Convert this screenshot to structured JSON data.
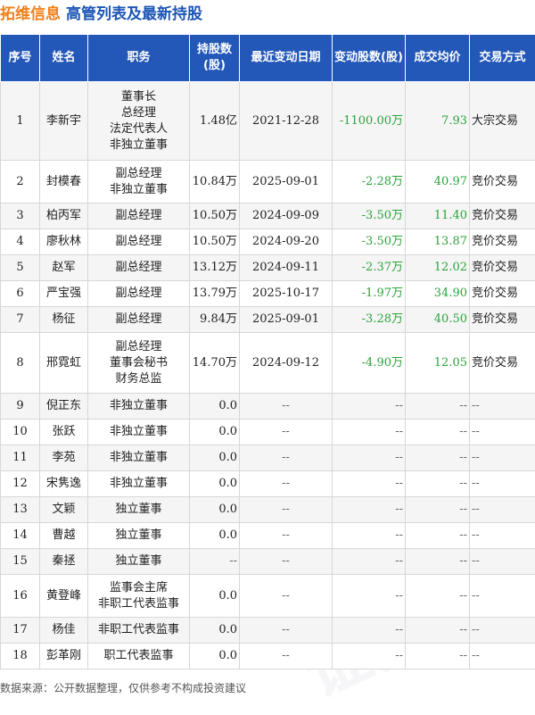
{
  "header": {
    "company": "拓维信息",
    "subtitle": "高管列表及最新持股"
  },
  "columns": [
    "序号",
    "姓名",
    "职务",
    "持股数(股)",
    "最近变动日期",
    "变动股数(股)",
    "成交均价",
    "交易方式"
  ],
  "rows": [
    {
      "no": "1",
      "name": "李新宇",
      "roles": [
        "董事长",
        "总经理",
        "法定代表人",
        "非独立董事"
      ],
      "shares": "1.48亿",
      "date": "2021-12-28",
      "change": "-1100.00万",
      "price": "7.93",
      "method": "大宗交易",
      "h": 88
    },
    {
      "no": "2",
      "name": "封模春",
      "roles": [
        "副总经理",
        "非独立董事"
      ],
      "shares": "10.84万",
      "date": "2025-09-01",
      "change": "-2.28万",
      "price": "40.97",
      "method": "竞价交易",
      "h": 48
    },
    {
      "no": "3",
      "name": "柏丙军",
      "roles": [
        "副总经理"
      ],
      "shares": "10.50万",
      "date": "2024-09-09",
      "change": "-3.50万",
      "price": "11.40",
      "method": "竞价交易",
      "h": 29
    },
    {
      "no": "4",
      "name": "廖秋林",
      "roles": [
        "副总经理"
      ],
      "shares": "10.50万",
      "date": "2024-09-20",
      "change": "-3.50万",
      "price": "13.87",
      "method": "竞价交易",
      "h": 29
    },
    {
      "no": "5",
      "name": "赵军",
      "roles": [
        "副总经理"
      ],
      "shares": "13.12万",
      "date": "2024-09-11",
      "change": "-2.37万",
      "price": "12.02",
      "method": "竞价交易",
      "h": 29
    },
    {
      "no": "6",
      "name": "严宝强",
      "roles": [
        "副总经理"
      ],
      "shares": "13.79万",
      "date": "2025-10-17",
      "change": "-1.97万",
      "price": "34.90",
      "method": "竞价交易",
      "h": 29
    },
    {
      "no": "7",
      "name": "杨征",
      "roles": [
        "副总经理"
      ],
      "shares": "9.84万",
      "date": "2025-09-01",
      "change": "-3.28万",
      "price": "40.50",
      "method": "竞价交易",
      "h": 29
    },
    {
      "no": "8",
      "name": "邢霓虹",
      "roles": [
        "副总经理",
        "董事会秘书",
        "财务总监"
      ],
      "shares": "14.70万",
      "date": "2024-09-12",
      "change": "-4.90万",
      "price": "12.05",
      "method": "竞价交易",
      "h": 68
    },
    {
      "no": "9",
      "name": "倪正东",
      "roles": [
        "非独立董事"
      ],
      "shares": "0.0",
      "date": "--",
      "change": "--",
      "price": "--",
      "method": "--",
      "h": 29
    },
    {
      "no": "10",
      "name": "张跃",
      "roles": [
        "非独立董事"
      ],
      "shares": "0.0",
      "date": "--",
      "change": "--",
      "price": "--",
      "method": "--",
      "h": 29
    },
    {
      "no": "11",
      "name": "李苑",
      "roles": [
        "非独立董事"
      ],
      "shares": "0.0",
      "date": "--",
      "change": "--",
      "price": "--",
      "method": "--",
      "h": 29
    },
    {
      "no": "12",
      "name": "宋隽逸",
      "roles": [
        "非独立董事"
      ],
      "shares": "0.0",
      "date": "--",
      "change": "--",
      "price": "--",
      "method": "--",
      "h": 29
    },
    {
      "no": "13",
      "name": "文颖",
      "roles": [
        "独立董事"
      ],
      "shares": "0.0",
      "date": "--",
      "change": "--",
      "price": "--",
      "method": "--",
      "h": 29
    },
    {
      "no": "14",
      "name": "曹越",
      "roles": [
        "独立董事"
      ],
      "shares": "0.0",
      "date": "--",
      "change": "--",
      "price": "--",
      "method": "--",
      "h": 29
    },
    {
      "no": "15",
      "name": "秦拯",
      "roles": [
        "独立董事"
      ],
      "shares": "--",
      "date": "--",
      "change": "--",
      "price": "--",
      "method": "--",
      "h": 29
    },
    {
      "no": "16",
      "name": "黄登峰",
      "roles": [
        "监事会主席",
        "非职工代表监事"
      ],
      "shares": "0.0",
      "date": "--",
      "change": "--",
      "price": "--",
      "method": "--",
      "h": 48
    },
    {
      "no": "17",
      "name": "杨佳",
      "roles": [
        "非职工代表监事"
      ],
      "shares": "0.0",
      "date": "--",
      "change": "--",
      "price": "--",
      "method": "--",
      "h": 29
    },
    {
      "no": "18",
      "name": "彭革刚",
      "roles": [
        "职工代表监事"
      ],
      "shares": "0.0",
      "date": "--",
      "change": "--",
      "price": "--",
      "method": "--",
      "h": 29
    }
  ],
  "footer": "数据来源：公开数据整理，仅供参考不构成投资建议",
  "watermark": "证券之星",
  "colors": {
    "header_bg": "#2458b8",
    "company": "#f07f1b",
    "subtitle": "#1c55b5",
    "negative": "#2ba33a"
  }
}
